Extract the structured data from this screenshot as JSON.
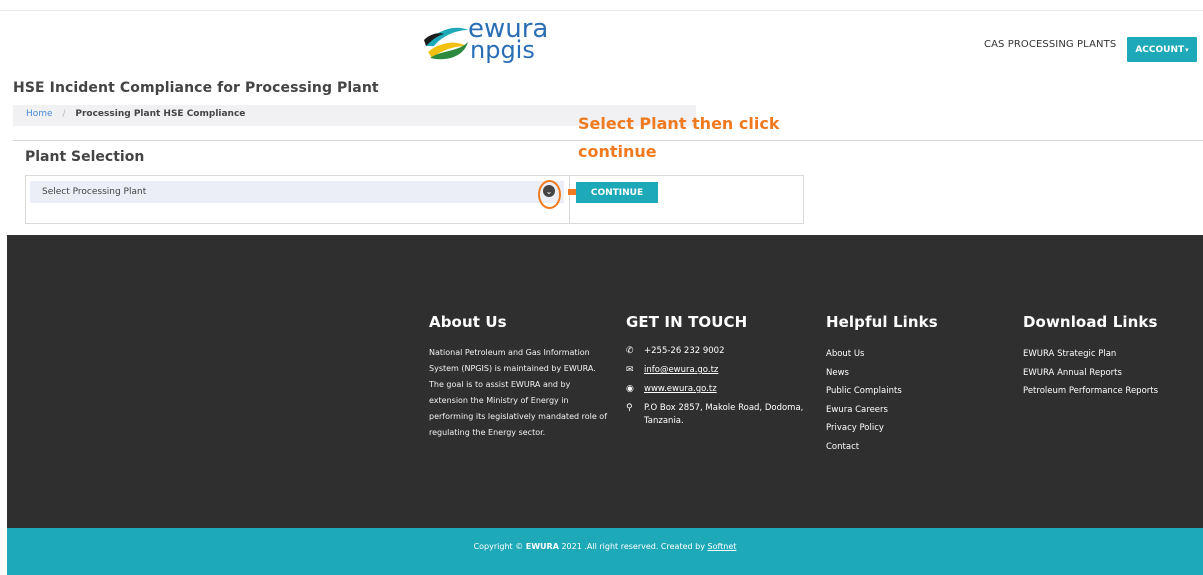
{
  "header": {
    "logo_line1": "ewura",
    "logo_line2": "npgis",
    "nav_cas": "CAS PROCESSING PLANTS",
    "account_label": "ACCOUNT"
  },
  "page": {
    "title": "HSE Incident Compliance for Processing Plant",
    "breadcrumb": {
      "home": "Home",
      "separator": "/",
      "current": "Processing Plant HSE Compliance"
    },
    "annotation_line1": "Select Plant then click",
    "annotation_line2": "continue",
    "section_title": "Plant Selection",
    "select_placeholder": "Select Processing Plant",
    "continue_label": "CONTINUE"
  },
  "footer": {
    "about": {
      "heading": "About Us",
      "text": "National Petroleum and Gas Information System (NPGIS) is maintained by EWURA. The goal is to assist EWURA and by extension the Ministry of Energy in performing its legislatively mandated role of regulating the Energy sector."
    },
    "contact": {
      "heading": "GET IN TOUCH",
      "phone": "+255-26 232 9002",
      "email": "info@ewura.go.tz",
      "website": "www.ewura.go.tz",
      "address": "P.O Box 2857, Makole Road, Dodoma, Tanzania."
    },
    "helpful": {
      "heading": "Helpful Links",
      "items": [
        "About Us",
        "News",
        "Public Complaints",
        "Ewura Careers",
        "Privacy Policy",
        "Contact"
      ]
    },
    "downloads": {
      "heading": "Download Links",
      "items": [
        "EWURA Strategic Plan",
        "EWURA Annual Reports",
        "Petroleum Performance Reports"
      ]
    },
    "copyright": {
      "prefix": "Copyright ©",
      "brand": "EWURA",
      "middle": "2021 .All right reserved. Created by",
      "creator": "Softnet"
    }
  },
  "colors": {
    "accent": "#1ea9b8",
    "annotation": "#f07a20",
    "footer_bg": "#2f2f2f"
  },
  "icons": [
    "phone-icon",
    "envelope-icon",
    "globe-icon",
    "map-pin-icon",
    "chevron-down-icon",
    "arrow-right-icon"
  ]
}
